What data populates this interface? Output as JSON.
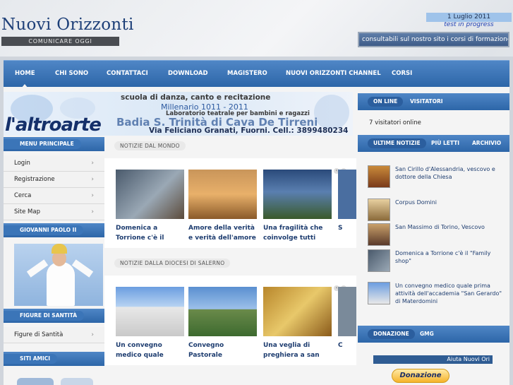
{
  "header": {
    "site_title": "Nuovi Orizzonti",
    "subtitle": "COMUNICARE OGGI",
    "date": "1 Luglio 2011",
    "test_text": "test in progress",
    "marquee": "consultabili sul nostro sito i corsi di formazione di"
  },
  "nav": {
    "items": [
      {
        "label": "HOME"
      },
      {
        "label": "CHI SONO"
      },
      {
        "label": "CONTATTACI"
      },
      {
        "label": "DOWNLOAD"
      },
      {
        "label": "MAGISTERO"
      },
      {
        "label": "NUOVI ORIZZONTI CHANNEL"
      },
      {
        "label": "CORSI"
      }
    ]
  },
  "banner": {
    "logo": "l'altroarte",
    "line1": "scuola di danza, canto e recitazione",
    "year": "Millenario 1011 - 2011",
    "line2": "Laboratorio teatrale per bambini e ragazzi",
    "line3": "Badia S. Trinità di Cava De Tirreni",
    "line4": "Via Feliciano Granati, Fuorni. Cell.: 3899480234"
  },
  "sidebar": {
    "main_menu_title": "MENU PRINCIPALE",
    "menu_items": [
      {
        "label": "Login"
      },
      {
        "label": "Registrazione"
      },
      {
        "label": "Cerca"
      },
      {
        "label": "Site Map"
      }
    ],
    "pope_title": "GIOVANNI PAOLO II",
    "saints_title": "FIGURE DI SANTITÀ",
    "saints_item": "Figure di Santità",
    "friends_title": "SITI AMICI"
  },
  "sections": {
    "world_title": "NOTIZIE DAL MONDO",
    "world_news": [
      {
        "title": "Domenica a Torrione c'è il \"Family shop\""
      },
      {
        "title": "Amore della verità e verità dell'amore"
      },
      {
        "title": "Una fragilità che coinvolge tutti"
      },
      {
        "title": "S"
      }
    ],
    "diocese_title": "NOTIZIE DALLA DIOCESI DI SALERNO",
    "diocese_news": [
      {
        "title": "Un convegno medico quale prima attività"
      },
      {
        "title": "Convegno Pastorale Diocesano Diocesi"
      },
      {
        "title": "Una veglia di preghiera a san"
      },
      {
        "title": "C"
      }
    ]
  },
  "right": {
    "tabs1": [
      "ON LINE",
      "VISITATORI"
    ],
    "visitors": "7 visitatori online",
    "tabs2": [
      "ULTIME NOTIZIE",
      "PIÙ LETTI",
      "ARCHIVIO"
    ],
    "latest": [
      {
        "title": "San Cirillo d'Alessandria, vescovo e dottore della Chiesa"
      },
      {
        "title": "Corpus Domini"
      },
      {
        "title": "San Massimo di Torino, Vescovo"
      },
      {
        "title": "Domenica a Torrione c'è il \"Family shop\""
      },
      {
        "title": "Un convegno medico quale prima attività dell'accademia \"San Gerardo\" di Materdomini"
      }
    ],
    "tabs3": [
      "DONAZIONE",
      "GMG"
    ],
    "aiuta": "Aiuta Nuovi Ori",
    "donate_button": "Donazione"
  },
  "colors": {
    "nav_blue": "#2d66a8",
    "title_blue": "#1d3f78",
    "link_blue": "#1d3c6f"
  }
}
